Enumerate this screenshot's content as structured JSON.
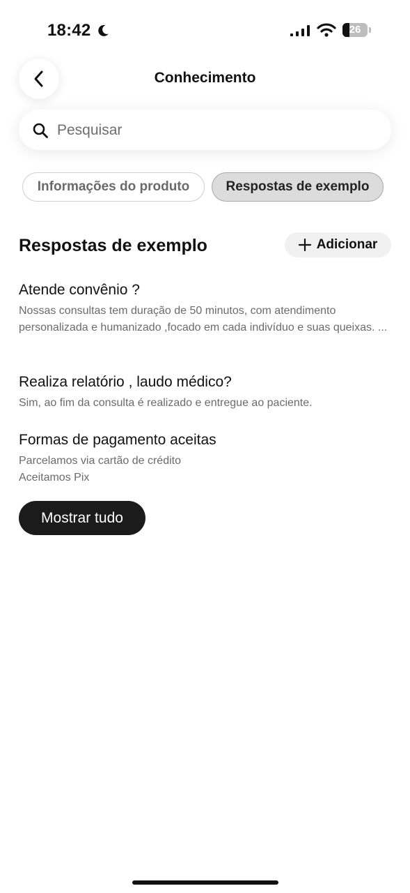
{
  "status_bar": {
    "time": "18:42",
    "battery_level": "26",
    "icons": [
      "moon-icon",
      "signal-icon",
      "wifi-icon",
      "battery-icon"
    ]
  },
  "header": {
    "title": "Conhecimento",
    "back_icon": "chevron-left-icon"
  },
  "search": {
    "placeholder": "Pesquisar",
    "value": "",
    "icon": "search-icon"
  },
  "tabs": [
    {
      "label": "Informações do produto",
      "selected": false
    },
    {
      "label": "Respostas de exemplo",
      "selected": true
    }
  ],
  "section": {
    "title": "Respostas de exemplo",
    "add_label": "Adicionar",
    "add_icon": "plus-icon"
  },
  "answers": [
    {
      "title": "Atende convênio ?",
      "body": "Nossas consultas tem duração de 50 minutos, com atendimento personalizada e humanizado ,focado em cada indivíduo e suas queixas. ..."
    },
    {
      "title": "Realiza relatório , laudo médico?",
      "body": "Sim, ao fim da consulta é realizado e entregue ao paciente."
    },
    {
      "title": "Formas de pagamento aceitas",
      "body_lines": [
        "Parcelamos via cartão de crédito",
        "Aceitamos Pix"
      ]
    }
  ],
  "show_all_label": "Mostrar tudo",
  "colors": {
    "primary_dark": "#1b1b1b",
    "tab_selected_bg": "#dcdcdc",
    "muted_text": "#6b6b6b"
  }
}
